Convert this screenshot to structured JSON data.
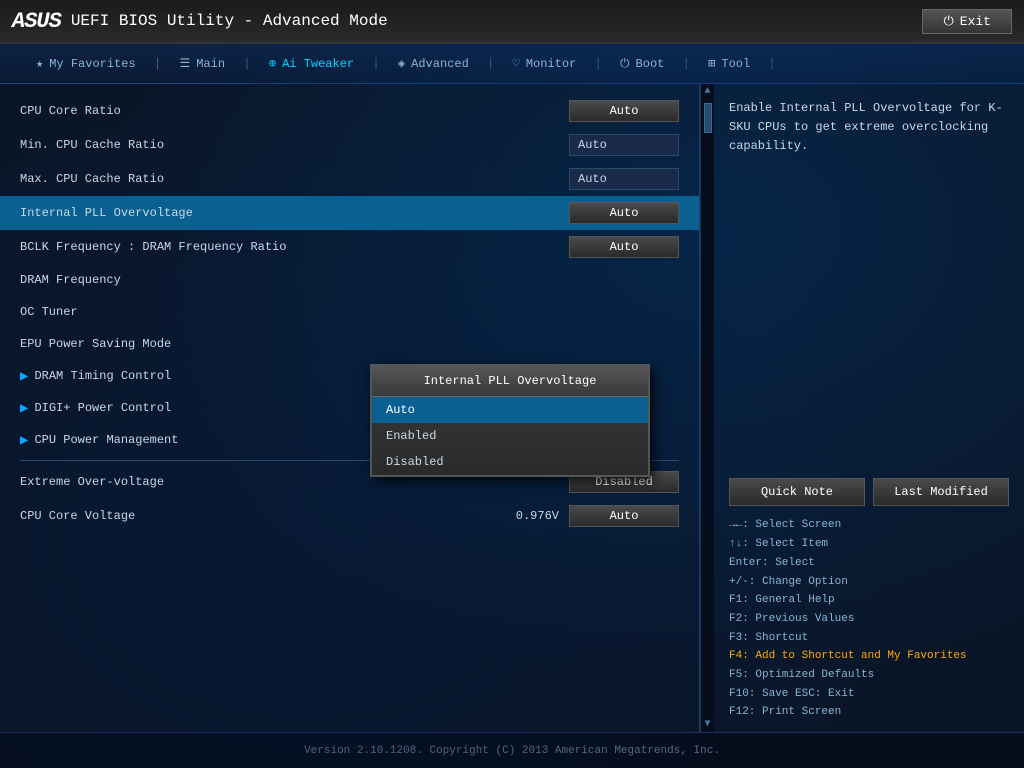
{
  "header": {
    "logo": "ASUS",
    "title": "UEFI BIOS Utility - Advanced Mode",
    "exit_label": "Exit"
  },
  "nav": {
    "items": [
      {
        "id": "my-favorites",
        "label": "My Favorites",
        "icon": "★"
      },
      {
        "id": "main",
        "label": "Main",
        "icon": "☰"
      },
      {
        "id": "ai-tweaker",
        "label": "Ai Tweaker",
        "icon": "⊕",
        "active": true
      },
      {
        "id": "advanced",
        "label": "Advanced",
        "icon": "◈"
      },
      {
        "id": "monitor",
        "label": "Monitor",
        "icon": "♡"
      },
      {
        "id": "boot",
        "label": "Boot",
        "icon": "⏻"
      },
      {
        "id": "tool",
        "label": "Tool",
        "icon": "⊞"
      }
    ]
  },
  "settings": [
    {
      "id": "cpu-core-ratio",
      "label": "CPU Core Ratio",
      "value_type": "button",
      "value": "Auto"
    },
    {
      "id": "min-cpu-cache-ratio",
      "label": "Min. CPU Cache Ratio",
      "value_type": "text",
      "value": "Auto"
    },
    {
      "id": "max-cpu-cache-ratio",
      "label": "Max. CPU Cache Ratio",
      "value_type": "text",
      "value": "Auto"
    },
    {
      "id": "internal-pll-overvoltage",
      "label": "Internal PLL Overvoltage",
      "value_type": "button",
      "value": "Auto",
      "highlighted": true
    },
    {
      "id": "bclk-dram-ratio",
      "label": "BCLK Frequency : DRAM Frequency Ratio",
      "value_type": "button",
      "value": "Auto"
    },
    {
      "id": "dram-frequency",
      "label": "DRAM Frequency",
      "value_type": "none"
    },
    {
      "id": "oc-tuner",
      "label": "OC Tuner",
      "value_type": "none"
    },
    {
      "id": "epu-power-saving",
      "label": "EPU Power Saving Mode",
      "value_type": "none"
    }
  ],
  "section_items": [
    {
      "id": "dram-timing-control",
      "label": "DRAM Timing Control"
    },
    {
      "id": "digi-power-control",
      "label": "DIGI+ Power Control"
    },
    {
      "id": "cpu-power-management",
      "label": "CPU Power Management"
    }
  ],
  "bottom_settings": [
    {
      "id": "extreme-overvoltage",
      "label": "Extreme Over-voltage",
      "value_type": "button",
      "value": "Disabled"
    },
    {
      "id": "cpu-core-voltage",
      "label": "CPU Core Voltage",
      "extra_value": "0.976V",
      "value_type": "button",
      "value": "Auto"
    }
  ],
  "dropdown": {
    "title": "Internal PLL Overvoltage",
    "options": [
      {
        "label": "Auto",
        "selected": true
      },
      {
        "label": "Enabled",
        "selected": false
      },
      {
        "label": "Disabled",
        "selected": false
      }
    ]
  },
  "info_panel": {
    "description": "Enable Internal PLL Overvoltage for K-SKU CPUs to get extreme overclocking capability."
  },
  "buttons": {
    "quick_note": "Quick Note",
    "last_modified": "Last Modified"
  },
  "help": {
    "lines": [
      "→←: Select Screen",
      "↑↓: Select Item",
      "Enter: Select",
      "+/-: Change Option",
      "F1: General Help",
      "F2: Previous Values",
      "F3: Shortcut",
      "F4: Add to Shortcut and My Favorites",
      "F5: Optimized Defaults",
      "F10: Save  ESC: Exit",
      "F12: Print Screen"
    ],
    "f4_line": "F4: Add to Shortcut and My Favorites"
  },
  "footer": {
    "text": "Version 2.10.1208. Copyright (C) 2013 American Megatrends, Inc."
  }
}
